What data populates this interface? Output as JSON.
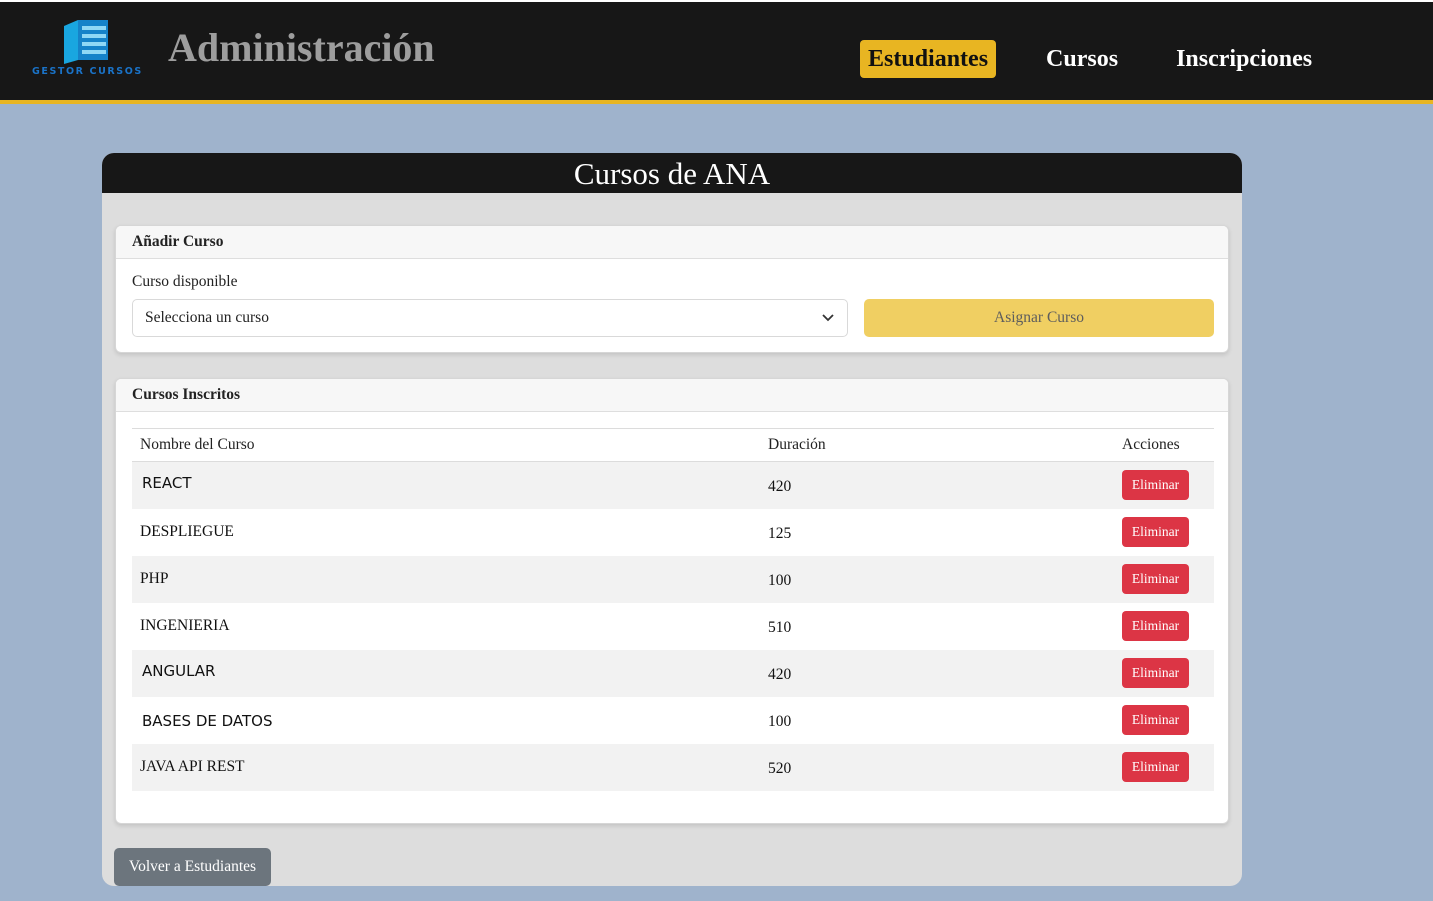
{
  "header": {
    "logo_text": "GESTOR CURSOS",
    "title": "Administración",
    "nav": [
      {
        "label": "Estudiantes",
        "active": true
      },
      {
        "label": "Cursos",
        "active": false
      },
      {
        "label": "Inscripciones",
        "active": false
      }
    ]
  },
  "panel": {
    "title": "Cursos de ANA"
  },
  "add_course": {
    "heading": "Añadir Curso",
    "field_label": "Curso disponible",
    "select_value": "Selecciona un curso",
    "assign_label": "Asignar Curso"
  },
  "enrolled": {
    "heading": "Cursos Inscritos",
    "columns": [
      "Nombre del Curso",
      "Duración",
      "Acciones"
    ],
    "rows": [
      {
        "name": "REACT",
        "duration": "420",
        "action": "Eliminar"
      },
      {
        "name": "DESPLIEGUE",
        "duration": "125",
        "action": "Eliminar"
      },
      {
        "name": "PHP",
        "duration": "100",
        "action": "Eliminar"
      },
      {
        "name": "INGENIERIA",
        "duration": "510",
        "action": "Eliminar"
      },
      {
        "name": "ANGULAR",
        "duration": "420",
        "action": "Eliminar"
      },
      {
        "name": "BASES DE DATOS",
        "duration": "100",
        "action": "Eliminar"
      },
      {
        "name": "JAVA API REST",
        "duration": "520",
        "action": "Eliminar"
      }
    ]
  },
  "back_label": "Volver a Estudiantes",
  "colors": {
    "background": "#9fb3cc",
    "header": "#171717",
    "accent": "#e8b522",
    "danger": "#dc3545",
    "secondary": "#6c757d"
  }
}
